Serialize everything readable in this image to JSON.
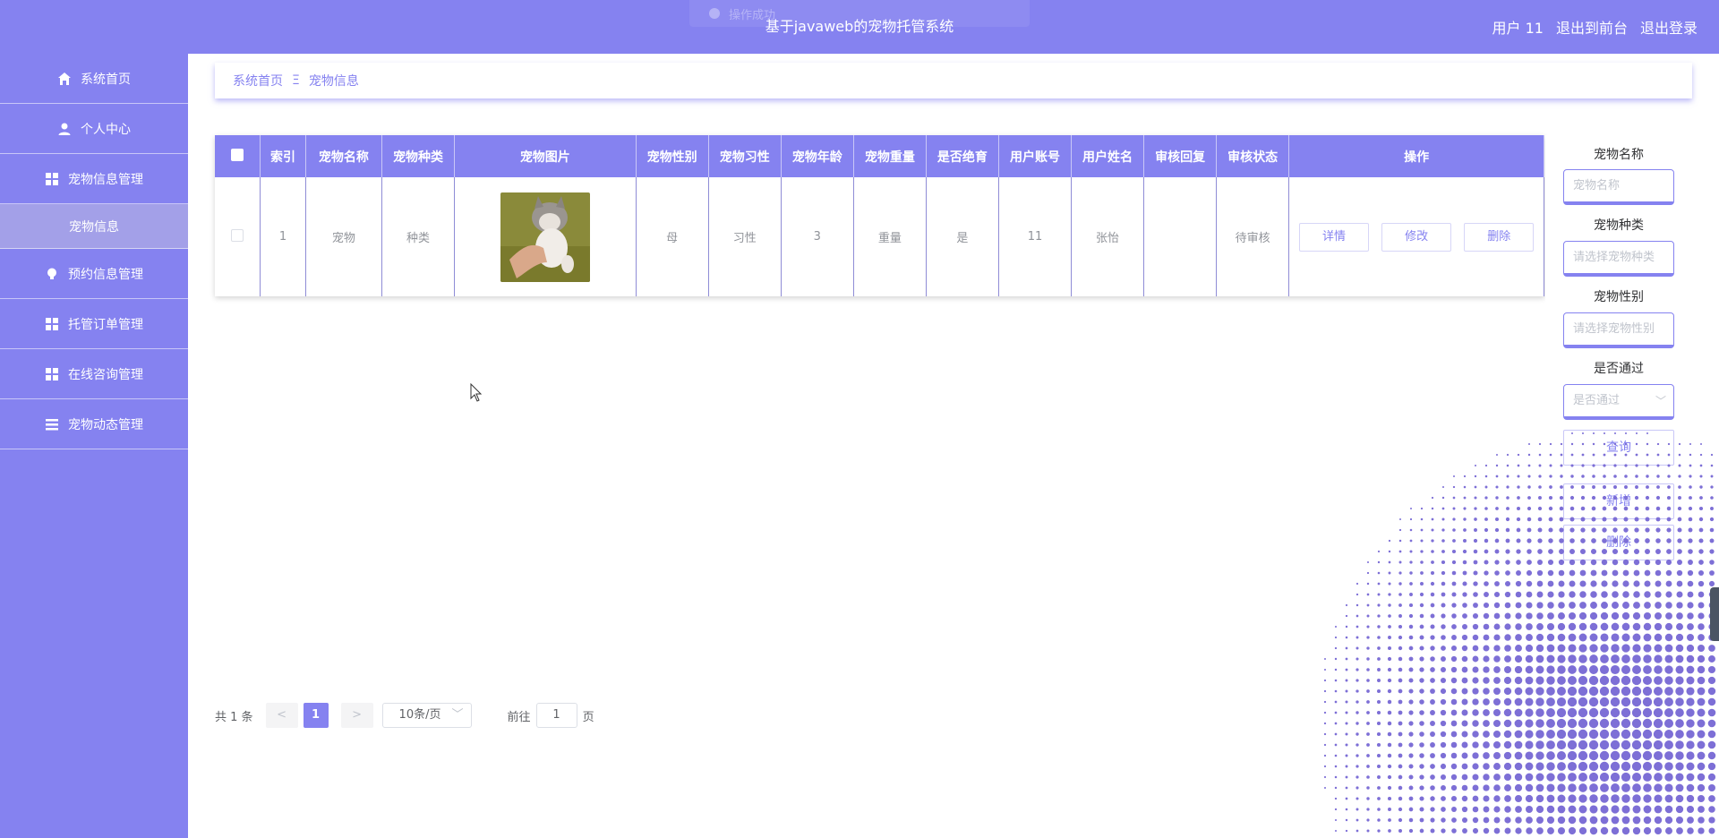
{
  "header": {
    "title": "基于javaweb的宠物托管系统",
    "user_label": "用户 11",
    "back_to_front": "退出到前台",
    "logout": "退出登录"
  },
  "toast": {
    "text": "操作成功"
  },
  "sidebar": {
    "items": [
      {
        "label": "系统首页",
        "icon": "home-icon"
      },
      {
        "label": "个人中心",
        "icon": "user-icon"
      },
      {
        "label": "宠物信息管理",
        "icon": "grid-icon"
      },
      {
        "label": "宠物信息",
        "icon": "",
        "sub": true
      },
      {
        "label": "预约信息管理",
        "icon": "bulb-icon"
      },
      {
        "label": "托管订单管理",
        "icon": "grid-icon"
      },
      {
        "label": "在线咨询管理",
        "icon": "grid-icon"
      },
      {
        "label": "宠物动态管理",
        "icon": "list-icon"
      }
    ]
  },
  "breadcrumb": {
    "home": "系统首页",
    "separator": "Ξ",
    "current": "宠物信息"
  },
  "table": {
    "headers": [
      "索引",
      "宠物名称",
      "宠物种类",
      "宠物图片",
      "宠物性别",
      "宠物习性",
      "宠物年龄",
      "宠物重量",
      "是否绝育",
      "用户账号",
      "用户姓名",
      "审核回复",
      "审核状态",
      "操作"
    ],
    "rows": [
      {
        "index": "1",
        "name": "宠物",
        "kind": "种类",
        "gender": "母",
        "habit": "习性",
        "age": "3",
        "weight": "重量",
        "neutered": "是",
        "account": "11",
        "username": "张怡",
        "reply": "",
        "status": "待审核"
      }
    ],
    "actions": {
      "detail": "详情",
      "edit": "修改",
      "delete": "删除"
    }
  },
  "search": {
    "name_label": "宠物名称",
    "name_placeholder": "宠物名称",
    "kind_label": "宠物种类",
    "kind_placeholder": "请选择宠物种类",
    "gender_label": "宠物性别",
    "gender_placeholder": "请选择宠物性别",
    "pass_label": "是否通过",
    "pass_placeholder": "是否通过",
    "query_button": "查询",
    "add_button": "新增",
    "delete_button": "删除"
  },
  "pagination": {
    "total": "共 1 条",
    "prev": "<",
    "current": "1",
    "next": ">",
    "page_size": "10条/页",
    "goto_prefix": "前往",
    "goto_value": "1",
    "goto_suffix": "页"
  },
  "colors": {
    "primary": "#8582f0",
    "sub_menu": "#a3a0e8"
  }
}
